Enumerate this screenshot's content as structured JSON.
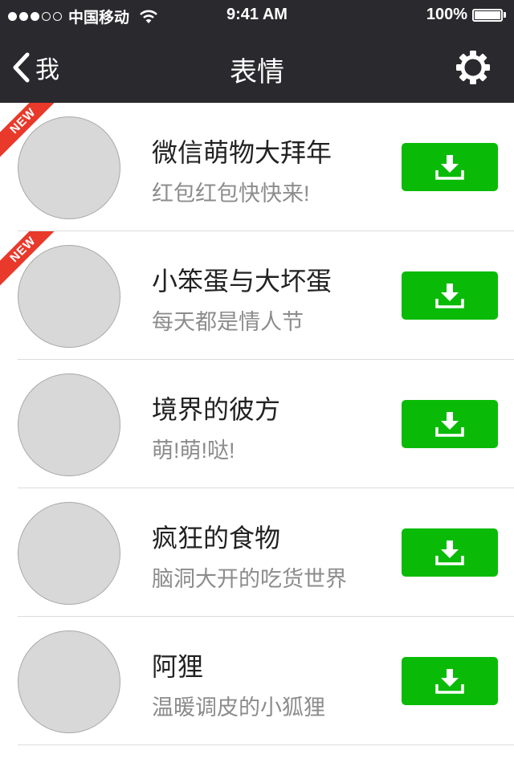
{
  "status_bar": {
    "carrier": "中国移动",
    "time": "9:41 AM",
    "battery": "100%"
  },
  "nav": {
    "back_label": "我",
    "title": "表情"
  },
  "badge_new": "NEW",
  "items": [
    {
      "title": "微信萌物大拜年",
      "subtitle": "红包红包快快来!",
      "is_new": true
    },
    {
      "title": "小笨蛋与大坏蛋",
      "subtitle": "每天都是情人节",
      "is_new": true
    },
    {
      "title": "境界的彼方",
      "subtitle": "萌!萌!哒!",
      "is_new": false
    },
    {
      "title": "疯狂的食物",
      "subtitle": "脑洞大开的吃货世界",
      "is_new": false
    },
    {
      "title": "阿狸",
      "subtitle": "温暖调皮的小狐狸",
      "is_new": false
    }
  ],
  "colors": {
    "header_bg": "#2a2a2e",
    "download_green": "#09bb07",
    "new_red": "#e8392b"
  },
  "icons": [
    "back-chevron-icon",
    "gear-icon",
    "download-icon",
    "wifi-icon",
    "battery-icon"
  ]
}
